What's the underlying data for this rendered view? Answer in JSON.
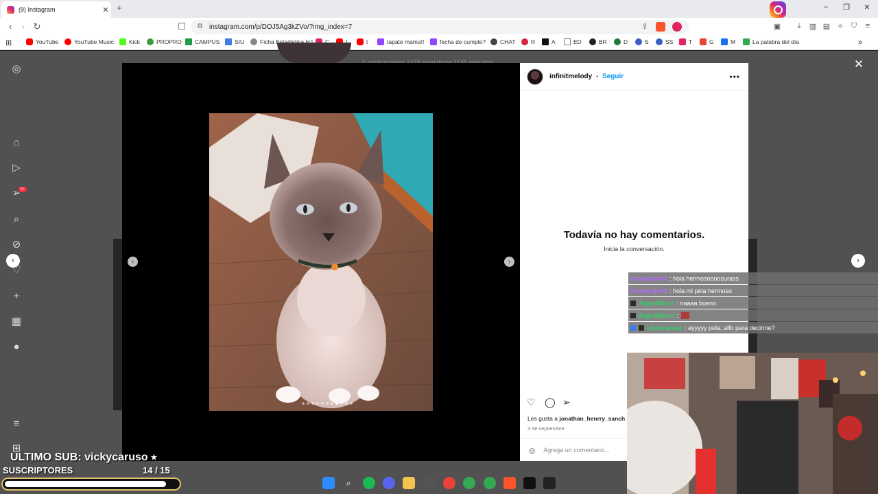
{
  "browser": {
    "tab_title": "(9) Instagram",
    "tab_close": "✕",
    "new_tab": "+",
    "url": "instagram.com/p/DOJ5Ag3kZVo/?img_index=7",
    "window_controls": [
      "–",
      "❐",
      "✕"
    ]
  },
  "bookmarks": [
    {
      "label": "YouTube",
      "color": "#ff0000"
    },
    {
      "label": "YouTube Music",
      "color": "#ff0000"
    },
    {
      "label": "Kick",
      "color": "#53fc18"
    },
    {
      "label": "PROPRO",
      "color": "#3a9d3a"
    },
    {
      "label": "CAMPUS",
      "color": "#1e9e4a"
    },
    {
      "label": "SIU",
      "color": "#3d7de0"
    },
    {
      "label": "Ficha Estadistica HJ",
      "color": "#888888"
    },
    {
      "label": "C",
      "color": "#e0245e"
    },
    {
      "label": "t",
      "color": "#ff0000"
    },
    {
      "label": "t",
      "color": "#ff0000"
    },
    {
      "label": "tapate mama!!",
      "color": "#9146ff"
    },
    {
      "label": "fecha de cumple?",
      "color": "#9146ff"
    },
    {
      "label": "CHAT",
      "color": "#444444"
    },
    {
      "label": "R",
      "color": "#d6243c"
    },
    {
      "label": "A",
      "color": "#111111"
    },
    {
      "label": "ED",
      "color": "#777777"
    },
    {
      "label": "BR",
      "color": "#222222"
    },
    {
      "label": "D",
      "color": "#1f7a3a"
    },
    {
      "label": "S",
      "color": "#3d5ac7"
    },
    {
      "label": "SS",
      "color": "#3d5ac7"
    },
    {
      "label": "T",
      "color": "#e0245e"
    },
    {
      "label": "G",
      "color": "#ea4335"
    },
    {
      "label": "M",
      "color": "#1a73e8"
    },
    {
      "label": "La palabra del día",
      "color": "#34a853"
    }
  ],
  "bookmarks_more": "»",
  "instagram": {
    "background_profile_stats": "5 publicaciones   1419 seguidores   1145 seguidos",
    "notifications_badge": "9+",
    "post": {
      "username": "infinitmelody",
      "separator": "•",
      "follow_label": "Seguir",
      "more_label": "•••",
      "empty_title": "Todavía no hay comentarios.",
      "empty_subtitle": "Inicia la conversación.",
      "likes_prefix": "Les gusta a",
      "likes_user": "jonathan_henrry_sanch",
      "date": "3 de septiembre",
      "comment_placeholder": "Agrega un comentario...",
      "carousel_dots": 11,
      "carousel_active_index": 7
    },
    "close_label": "✕",
    "prev_label": "‹",
    "next_label": "›"
  },
  "stream_chat": [
    {
      "user": "looooonjon8",
      "user_color": "#b36bff",
      "message": ": hola hermosoooosurass"
    },
    {
      "user": "looooonjon8",
      "user_color": "#b36bff",
      "message": ": hola mi pela hermoso"
    },
    {
      "user": "ArgonBenur",
      "user_color": "#2fd36b",
      "message": ": naaaa bueno"
    },
    {
      "user": "ArgonBenur",
      "user_color": "#2fd36b",
      "message": ":"
    },
    {
      "user": "vickycaruso",
      "user_color": "#2fd36b",
      "message": ": ayyyyy pela, alfo para decirme?"
    }
  ],
  "overlay": {
    "last_sub": "ULTIMO SUB: vickycaruso ⭑",
    "subs_title": "SUSCRIPTORES",
    "subs_count": "14  / 15",
    "subs_progress": 0.933
  },
  "colors": {
    "instagram_blue": "#0095f6",
    "progress_border": "#e3c46b"
  }
}
